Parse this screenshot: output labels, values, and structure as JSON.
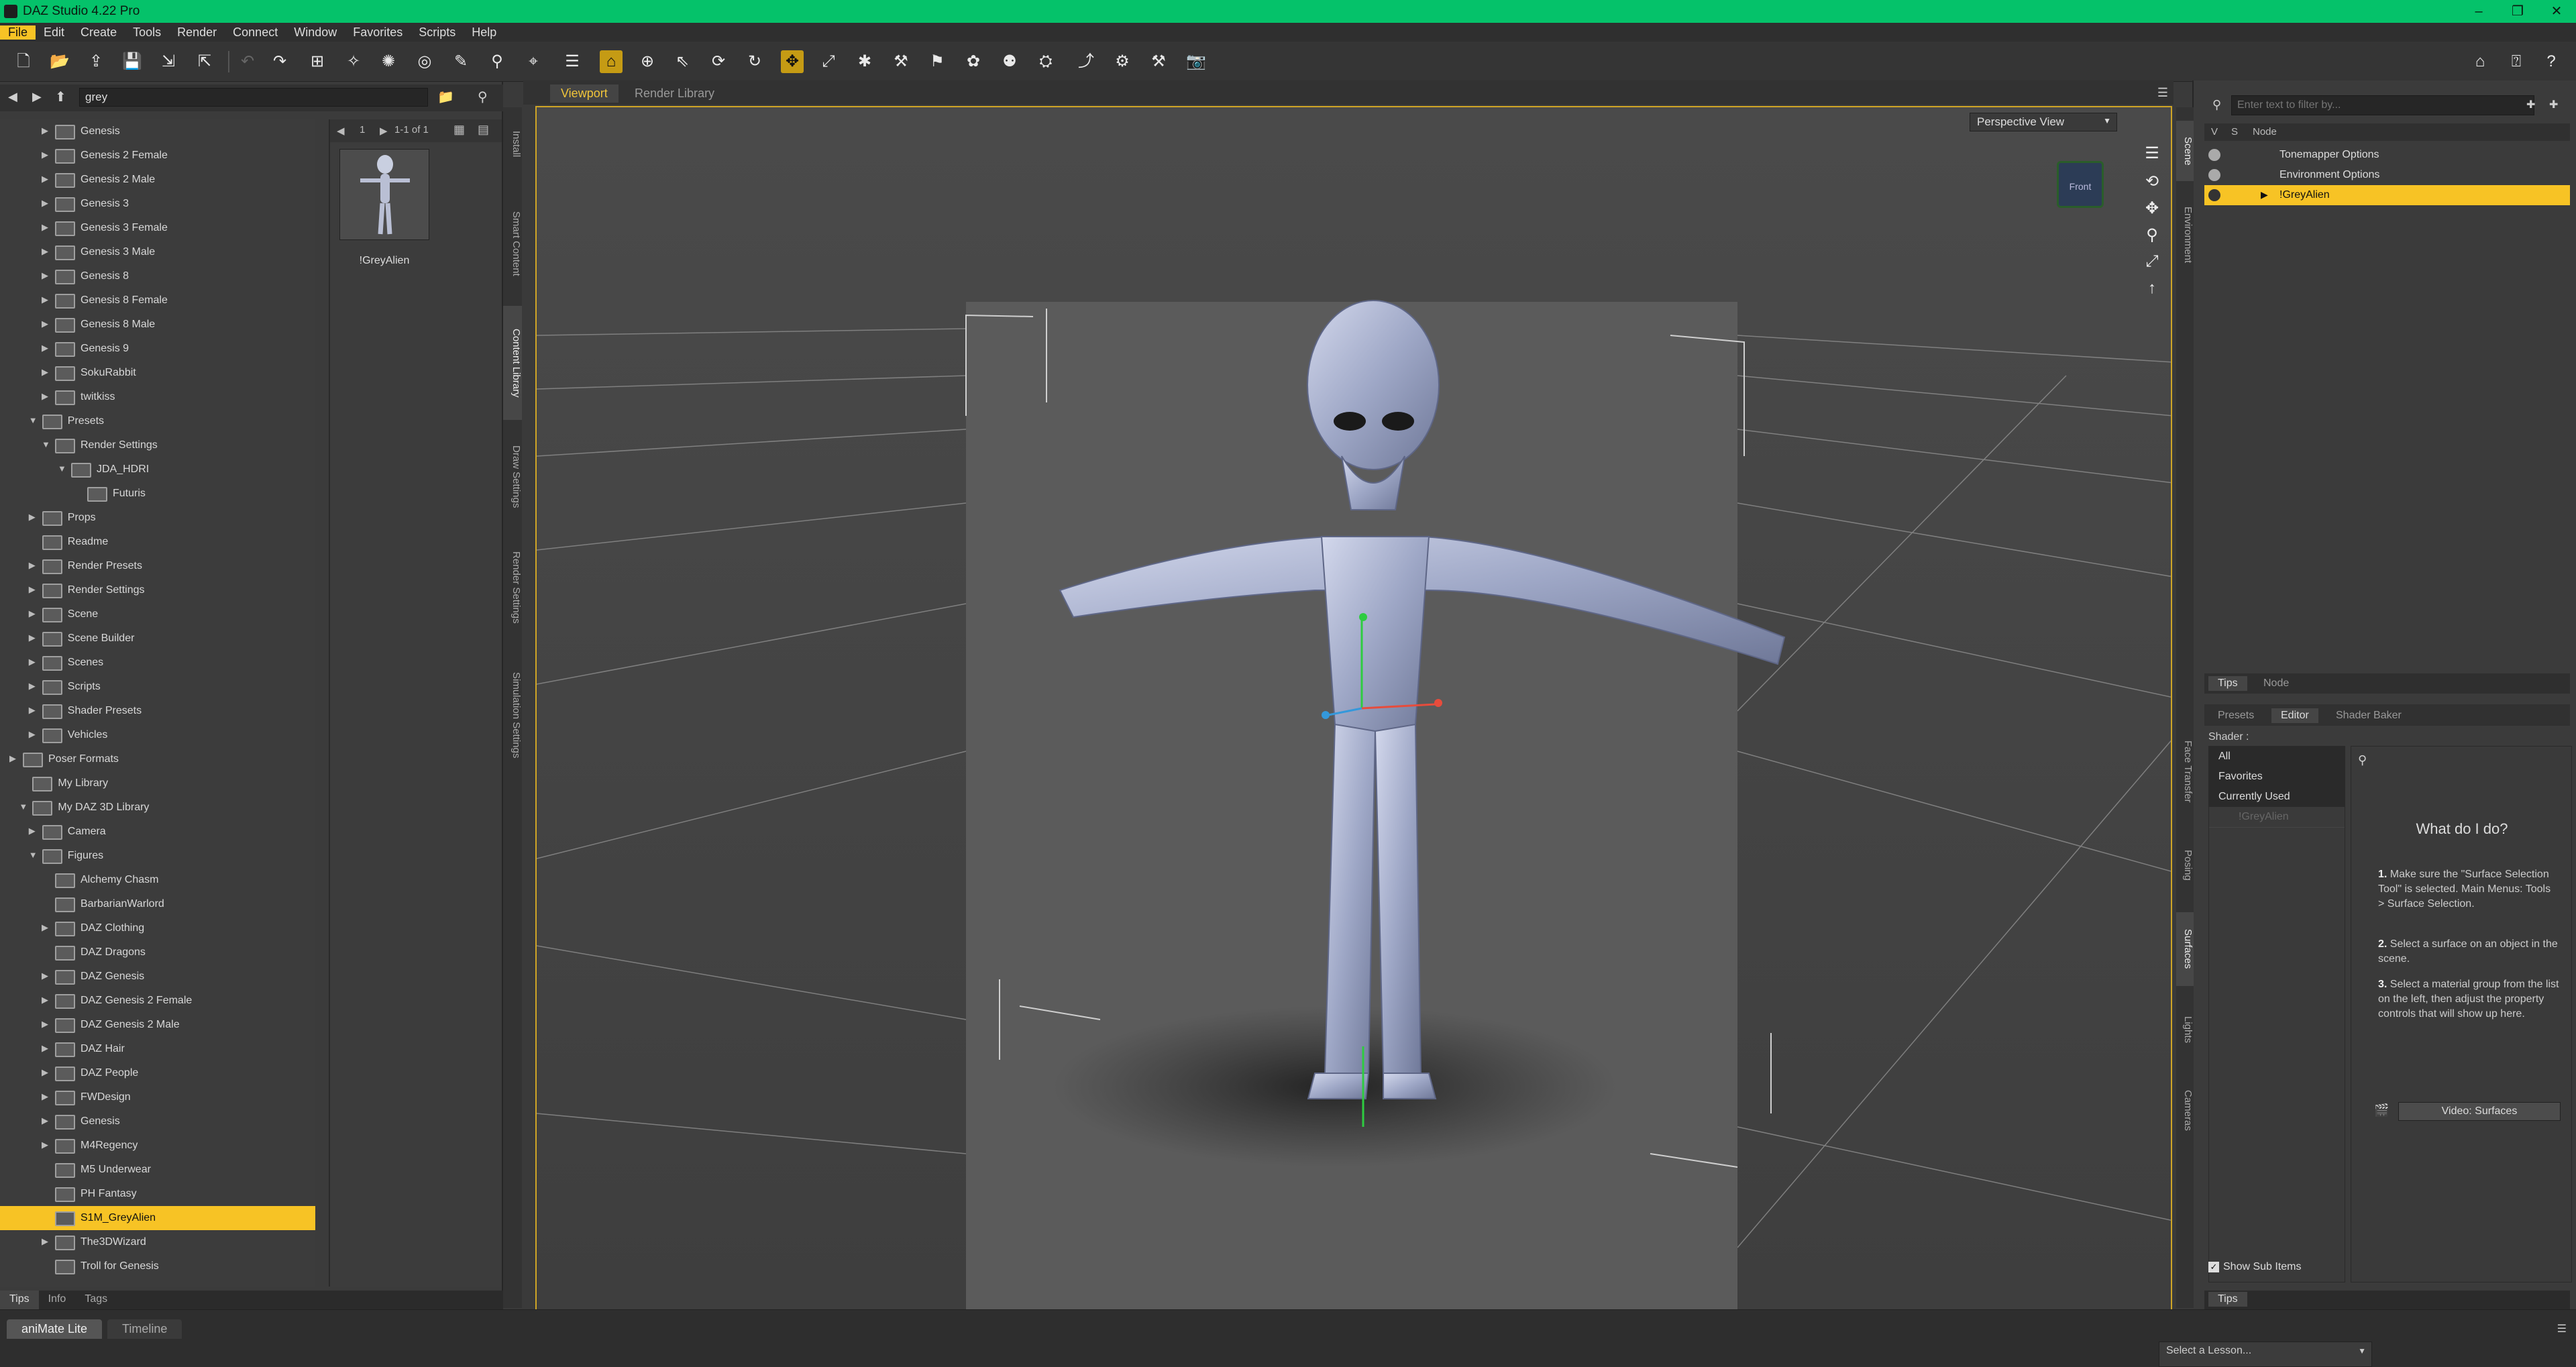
{
  "window": {
    "title": "DAZ Studio 4.22 Pro",
    "controls": [
      "–",
      "❐",
      "✕"
    ]
  },
  "menu": [
    "File",
    "Edit",
    "Create",
    "Tools",
    "Render",
    "Connect",
    "Window",
    "Favorites",
    "Scripts",
    "Help"
  ],
  "content_library": {
    "search_value": "grey",
    "tree": [
      {
        "label": "Genesis",
        "indent": 1,
        "arrow": "▶"
      },
      {
        "label": "Genesis 2 Female",
        "indent": 1,
        "arrow": "▶"
      },
      {
        "label": "Genesis 2 Male",
        "indent": 1,
        "arrow": "▶"
      },
      {
        "label": "Genesis 3",
        "indent": 1,
        "arrow": "▶"
      },
      {
        "label": "Genesis 3 Female",
        "indent": 1,
        "arrow": "▶"
      },
      {
        "label": "Genesis 3 Male",
        "indent": 1,
        "arrow": "▶"
      },
      {
        "label": "Genesis 8",
        "indent": 1,
        "arrow": "▶"
      },
      {
        "label": "Genesis 8 Female",
        "indent": 1,
        "arrow": "▶"
      },
      {
        "label": "Genesis 8 Male",
        "indent": 1,
        "arrow": "▶"
      },
      {
        "label": "Genesis 9",
        "indent": 1,
        "arrow": "▶"
      },
      {
        "label": "SokuRabbit",
        "indent": 1,
        "arrow": "▶"
      },
      {
        "label": "twitkiss",
        "indent": 1,
        "arrow": "▶"
      },
      {
        "label": "Presets",
        "indent": 0.6,
        "arrow": "▼"
      },
      {
        "label": "Render Settings",
        "indent": 1,
        "arrow": "▼"
      },
      {
        "label": "JDA_HDRI",
        "indent": 1.5,
        "arrow": "▼"
      },
      {
        "label": "Futuris",
        "indent": 2,
        "arrow": ""
      },
      {
        "label": "Props",
        "indent": 0.6,
        "arrow": "▶"
      },
      {
        "label": "Readme",
        "indent": 0.6,
        "arrow": ""
      },
      {
        "label": "Render Presets",
        "indent": 0.6,
        "arrow": "▶"
      },
      {
        "label": "Render Settings",
        "indent": 0.6,
        "arrow": "▶"
      },
      {
        "label": "Scene",
        "indent": 0.6,
        "arrow": "▶"
      },
      {
        "label": "Scene Builder",
        "indent": 0.6,
        "arrow": "▶"
      },
      {
        "label": "Scenes",
        "indent": 0.6,
        "arrow": "▶"
      },
      {
        "label": "Scripts",
        "indent": 0.6,
        "arrow": "▶"
      },
      {
        "label": "Shader Presets",
        "indent": 0.6,
        "arrow": "▶"
      },
      {
        "label": "Vehicles",
        "indent": 0.6,
        "arrow": "▶"
      },
      {
        "label": "Poser Formats",
        "indent": 0,
        "arrow": "▶",
        "section": true
      },
      {
        "label": "My Library",
        "indent": 0.3,
        "arrow": ""
      },
      {
        "label": "My DAZ 3D Library",
        "indent": 0.3,
        "arrow": "▼"
      },
      {
        "label": "Camera",
        "indent": 0.6,
        "arrow": "▶"
      },
      {
        "label": "Figures",
        "indent": 0.6,
        "arrow": "▼"
      },
      {
        "label": "Alchemy Chasm",
        "indent": 1,
        "arrow": ""
      },
      {
        "label": "BarbarianWarlord",
        "indent": 1,
        "arrow": ""
      },
      {
        "label": "DAZ Clothing",
        "indent": 1,
        "arrow": "▶"
      },
      {
        "label": "DAZ Dragons",
        "indent": 1,
        "arrow": ""
      },
      {
        "label": "DAZ Genesis",
        "indent": 1,
        "arrow": "▶"
      },
      {
        "label": "DAZ Genesis 2 Female",
        "indent": 1,
        "arrow": "▶"
      },
      {
        "label": "DAZ Genesis 2 Male",
        "indent": 1,
        "arrow": "▶"
      },
      {
        "label": "DAZ Hair",
        "indent": 1,
        "arrow": "▶"
      },
      {
        "label": "DAZ People",
        "indent": 1,
        "arrow": "▶"
      },
      {
        "label": "FWDesign",
        "indent": 1,
        "arrow": "▶"
      },
      {
        "label": "Genesis",
        "indent": 1,
        "arrow": "▶"
      },
      {
        "label": "M4Regency",
        "indent": 1,
        "arrow": "▶"
      },
      {
        "label": "M5 Underwear",
        "indent": 1,
        "arrow": ""
      },
      {
        "label": "PH Fantasy",
        "indent": 1,
        "arrow": ""
      },
      {
        "label": "S1M_GreyAlien",
        "indent": 1,
        "arrow": "",
        "selected": true
      },
      {
        "label": "The3DWizard",
        "indent": 1,
        "arrow": "▶"
      },
      {
        "label": "Troll for Genesis",
        "indent": 1,
        "arrow": ""
      }
    ],
    "page_label": "1",
    "count_label": "1-1 of 1",
    "thumb_label": "!GreyAlien",
    "bottom_tabs": [
      "Tips",
      "Info",
      "Tags"
    ]
  },
  "left_vertical_tabs": [
    "Install",
    "Smart Content",
    "Content Library",
    "Draw Settings",
    "Render Settings",
    "Simulation Settings"
  ],
  "viewport": {
    "tabs": [
      "Viewport",
      "Render Library"
    ],
    "view_select": "Perspective View",
    "navcube_label": "Front"
  },
  "scene": {
    "filter_placeholder": "Enter text to filter by...",
    "headers": [
      "V",
      "S",
      "Node"
    ],
    "nodes": [
      {
        "label": "Tonemapper Options"
      },
      {
        "label": "Environment Options"
      },
      {
        "label": "!GreyAlien",
        "selected": true
      }
    ],
    "tabs": [
      "Tips",
      "Node"
    ]
  },
  "right_vertical_tabs": [
    "Scene",
    "Environment",
    "Face Transfer",
    "Posing",
    "Surfaces",
    "Lights",
    "Cameras"
  ],
  "surfaces": {
    "tabs": [
      "Presets",
      "Editor",
      "Shader Baker"
    ],
    "shader_label": "Shader :",
    "list": [
      "All",
      "Favorites",
      "Currently Used"
    ],
    "list_item_faded": "!GreyAlien",
    "help_title": "What do I do?",
    "steps": [
      {
        "num": "1.",
        "text": "Make sure the \"Surface Selection Tool\" is selected. Main Menus: Tools > Surface Selection."
      },
      {
        "num": "2.",
        "text": "Select a surface on an object in the scene."
      },
      {
        "num": "3.",
        "text": "Select a material group from the list on the left, then adjust the property controls that will show up here."
      }
    ],
    "video_button": "Video: Surfaces",
    "show_sub_items": "Show Sub Items",
    "bottom_tab": "Tips"
  },
  "bottom": {
    "tabs": [
      "aniMate Lite",
      "Timeline"
    ],
    "lesson": "Select a Lesson..."
  },
  "colors": {
    "accent": "#f7c325",
    "titlebar": "#05c26a",
    "viewport_border": "#cfa526"
  }
}
